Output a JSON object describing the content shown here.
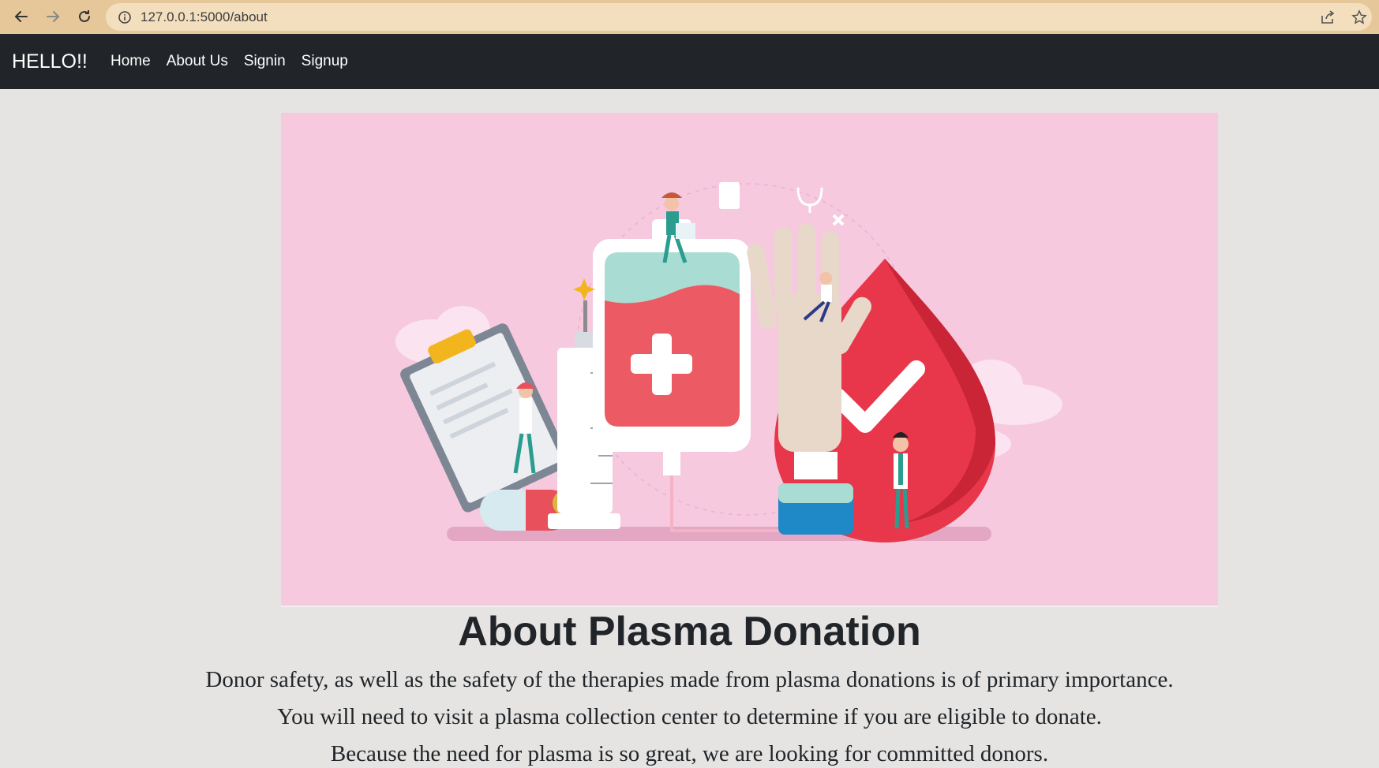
{
  "browser": {
    "url": "127.0.0.1:5000/about",
    "icons": [
      "back-arrow-icon",
      "forward-arrow-icon",
      "reload-icon",
      "info-icon",
      "share-icon",
      "bookmark-star-icon"
    ]
  },
  "navbar": {
    "brand": "HELLO!!",
    "links": [
      {
        "label": "Home"
      },
      {
        "label": "About Us"
      },
      {
        "label": "Signin"
      },
      {
        "label": "Signup"
      }
    ]
  },
  "hero": {
    "illustration": "plasma-donation-illustration",
    "background_color": "#f6c9df"
  },
  "content": {
    "title": "About Plasma Donation",
    "paragraphs": [
      "Donor safety, as well as the safety of the therapies made from plasma donations is of primary importance.",
      "You will need to visit a plasma collection center to determine if you are eligible to donate.",
      "Because the need for plasma is so great, we are looking for committed donors."
    ]
  },
  "colors": {
    "browser_bar": "#e5c79a",
    "navbar": "#212529",
    "page_background": "#e5e4e2",
    "blood_red": "#e8374a"
  }
}
